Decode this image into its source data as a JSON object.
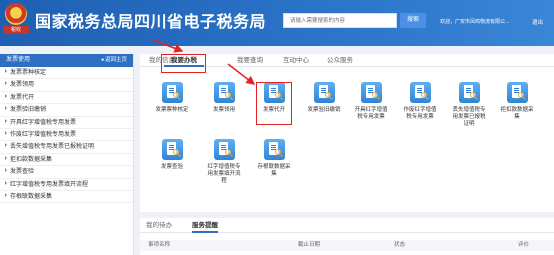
{
  "header": {
    "site_title": "国家税务总局四川省电子税务局",
    "emblem_caption": "税收",
    "search_placeholder": "请输入需要搜索的内容",
    "search_button": "搜索",
    "welcome": "欢迎，广安市凤鸣物流有限公...",
    "logout": "退出",
    "brand_color": "#2a6cc0"
  },
  "sidebar": {
    "title": "发票使用",
    "back_label": "返回主页",
    "items": [
      "发票票种核定",
      "发票领用",
      "发票代开",
      "发票验旧缴销",
      "开具红字增值税专用发票",
      "作废红字增值税专用发票",
      "丢失增值税专用发票已报税证明",
      "拒扣款数据采集",
      "发票查验",
      "红字增值税专用发票填开流程",
      "存根联数据采集"
    ]
  },
  "main": {
    "tabs": [
      "我的信息",
      "我要办税",
      "我要查询",
      "互动中心",
      "公众服务"
    ],
    "active_tab": 1,
    "services": [
      [
        "发票票种核定"
      ],
      [
        "发票领用"
      ],
      [
        "发票代开"
      ],
      [
        "发票验旧缴销"
      ],
      [
        "开具红字增值",
        "税专用发票"
      ],
      [
        "作废红字增值",
        "税专用发票"
      ],
      [
        "丢失增值税专",
        "用发票已报税",
        "证明"
      ],
      [
        "拒扣款数据采",
        "集"
      ],
      [
        "发票查验"
      ],
      [
        "红字增值税专",
        "用发票填开流",
        "程"
      ],
      [
        "存根联数据采",
        "集"
      ]
    ]
  },
  "bottom": {
    "tabs": [
      "我的待办",
      "服务提醒"
    ],
    "active_tab": 1,
    "columns": [
      "事项名称",
      "截止日期",
      "状态",
      "评价"
    ]
  }
}
